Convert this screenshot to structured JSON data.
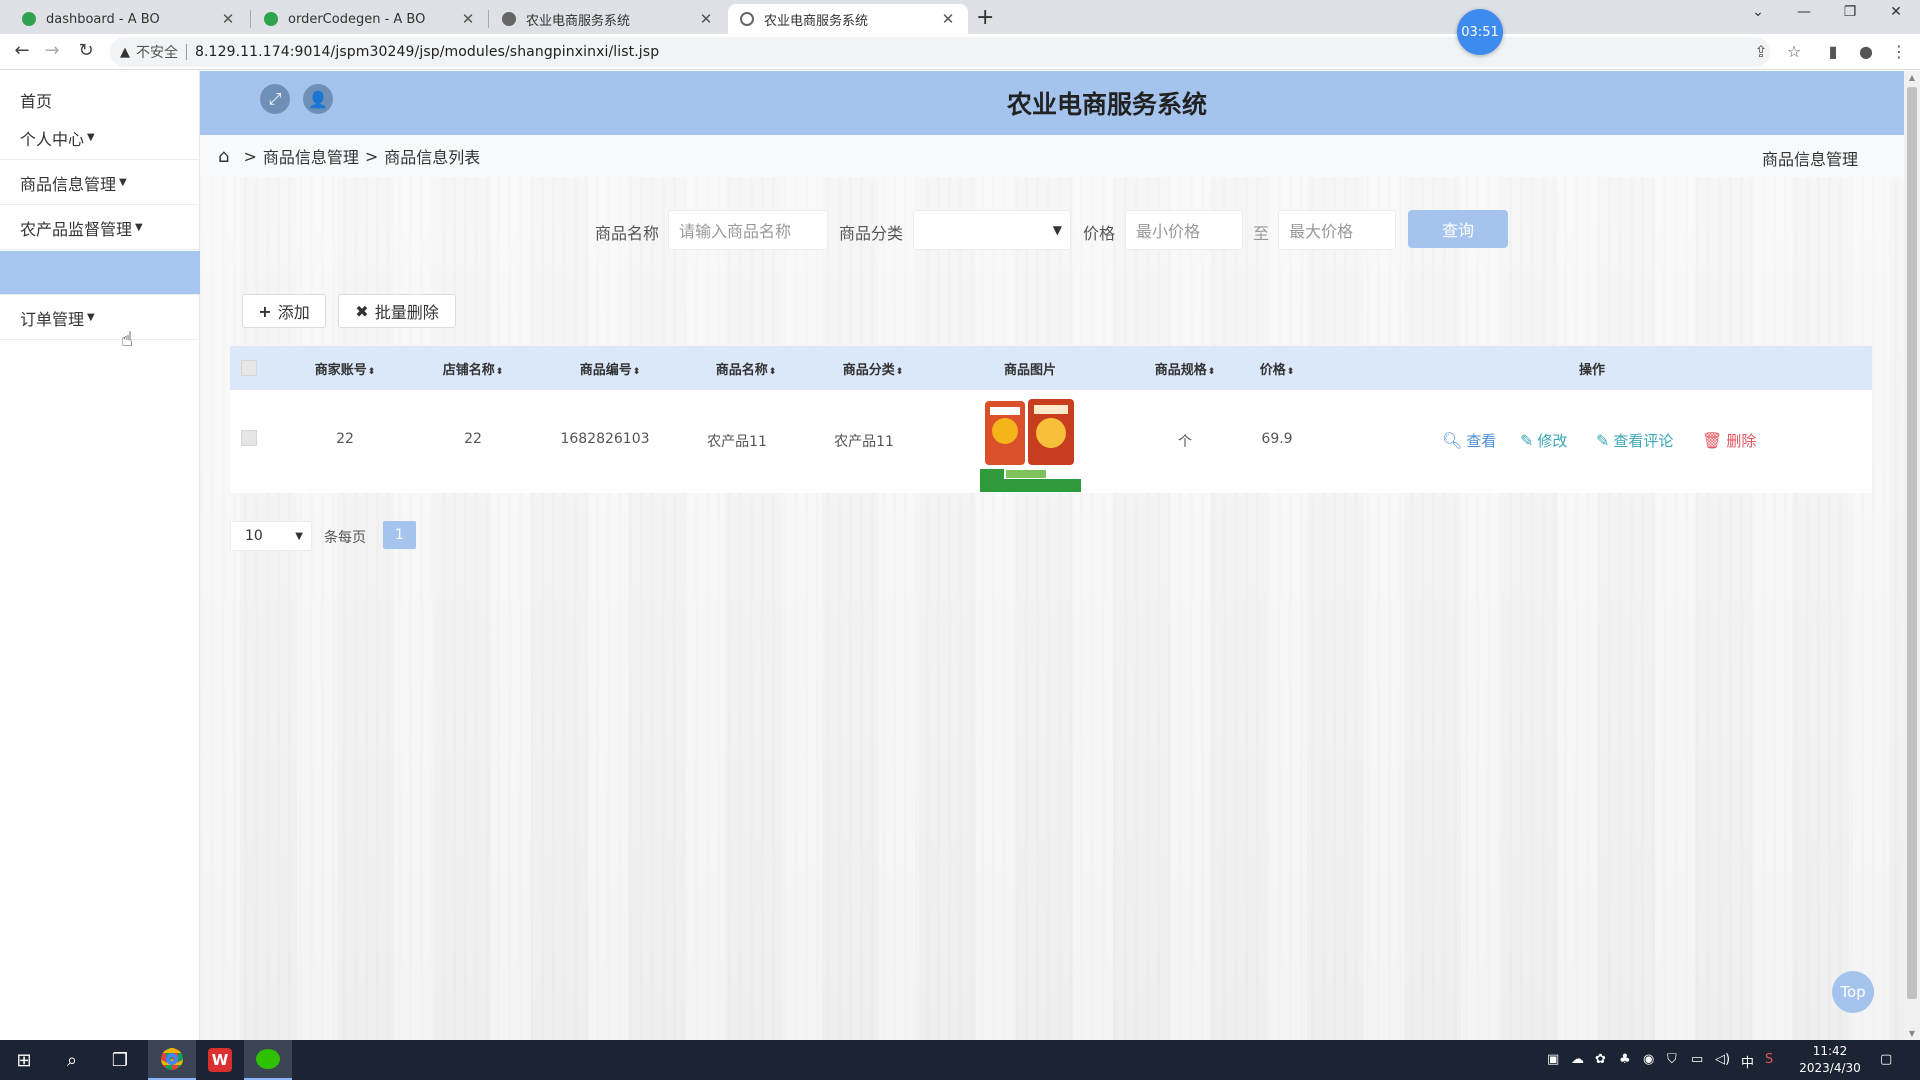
{
  "browser": {
    "tabs": [
      {
        "label": "dashboard - A BO",
        "active": false
      },
      {
        "label": "orderCodegen - A BO",
        "active": false
      },
      {
        "label": "农业电商服务系统",
        "active": false
      },
      {
        "label": "农业电商服务系统",
        "active": true
      }
    ],
    "recording_timer": "03:51",
    "insecure_label": "不安全",
    "url": "8.129.11.174:9014/jspm30249/jsp/modules/shangpinxinxi/list.jsp"
  },
  "app": {
    "title": "农业电商服务系统"
  },
  "sidebar": {
    "items": [
      {
        "label": "首页",
        "has_caret": false
      },
      {
        "label": "个人中心",
        "has_caret": true
      },
      {
        "label": "商品信息管理",
        "has_caret": true
      },
      {
        "label": "农产品监督管理",
        "has_caret": true
      },
      {
        "label": "",
        "has_caret": false,
        "active": true
      },
      {
        "label": "订单管理",
        "has_caret": true
      }
    ]
  },
  "breadcrumb": {
    "items": [
      "商品信息管理",
      "商品信息列表"
    ],
    "right_label": "商品信息管理"
  },
  "search": {
    "name_label": "商品名称",
    "name_placeholder": "请输入商品名称",
    "category_label": "商品分类",
    "category_value": "",
    "price_label": "价格",
    "min_placeholder": "最小价格",
    "to_label": "至",
    "max_placeholder": "最大价格",
    "button": "查询"
  },
  "actions": {
    "add": "添加",
    "batch_delete": "批量删除"
  },
  "table": {
    "columns": [
      "商家账号",
      "店铺名称",
      "商品编号",
      "商品名称",
      "商品分类",
      "商品图片",
      "商品规格",
      "价格",
      "操作"
    ],
    "rows": [
      {
        "merchant": "22",
        "shop": "22",
        "code": "1682826103",
        "name": "农产品11",
        "category": "农产品11",
        "spec": "个",
        "price": "69.9"
      }
    ],
    "row_actions": {
      "view": "查看",
      "edit": "修改",
      "comments": "查看评论",
      "delete": "删除"
    }
  },
  "pagination": {
    "page_size": "10",
    "per_page_label": "条每页",
    "current_page": "1"
  },
  "top_button": "Top",
  "taskbar": {
    "ime": "中",
    "time": "11:42",
    "date": "2023/4/30"
  },
  "colors": {
    "accent": "#a4c4ee",
    "header_bg": "#a4c4ee",
    "table_head_bg": "#dae8fa",
    "delete_red": "#e2545d",
    "link_blue": "#4a90d8"
  }
}
